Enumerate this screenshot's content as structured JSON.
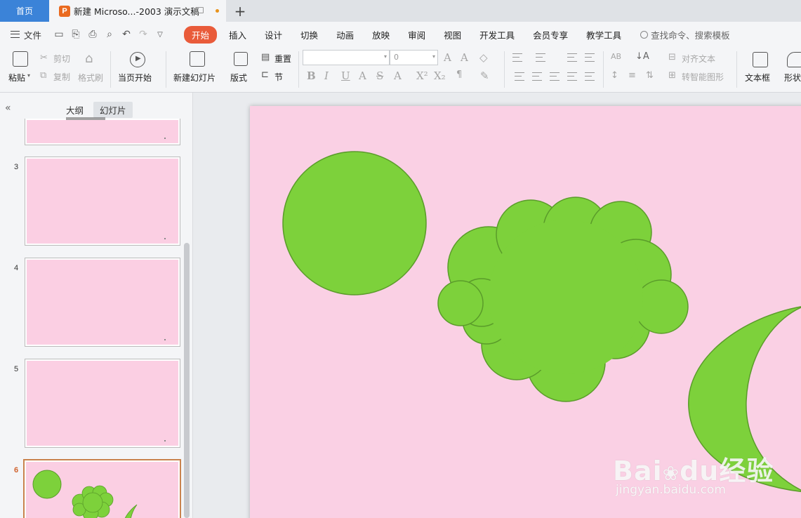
{
  "tabs": {
    "home": "首页",
    "document": "新建 Microso...-2003 演示文稿",
    "add": "+"
  },
  "menu": {
    "file": "文件",
    "items": [
      "开始",
      "插入",
      "设计",
      "切换",
      "动画",
      "放映",
      "审阅",
      "视图",
      "开发工具",
      "会员专享",
      "教学工具"
    ],
    "active": "开始",
    "search_placeholder": "查找命令、搜索模板"
  },
  "ribbon": {
    "paste": "粘贴",
    "cut": "剪切",
    "copy": "复制",
    "format_painter": "格式刷",
    "play_from_current": "当页开始",
    "new_slide": "新建幻灯片",
    "layout": "版式",
    "reset": "重置",
    "section": "节",
    "font_size_value": "0",
    "align_text": "对齐文本",
    "smartart": "转智能图形",
    "textbox": "文本框",
    "shape": "形状"
  },
  "panel": {
    "tab_outline": "大纲",
    "tab_slides": "幻灯片",
    "active_tab": "幻灯片",
    "slide_numbers": [
      "3",
      "4",
      "5",
      "6"
    ],
    "selected_slide": "6"
  },
  "slide": {
    "background_color": "#fad0e4",
    "shape_fill": "#7dd13b",
    "shape_stroke": "#5a9c2a",
    "shapes": [
      "circle",
      "cloud",
      "moon"
    ]
  },
  "watermark": {
    "brand": "Bai",
    "brand_suffix": "du",
    "product": "经验",
    "url": "jingyan.baidu.com"
  },
  "colors": {
    "accent": "#e95b3a",
    "home_tab": "#3b83d8",
    "selected_thumb_border": "#c9834d"
  }
}
